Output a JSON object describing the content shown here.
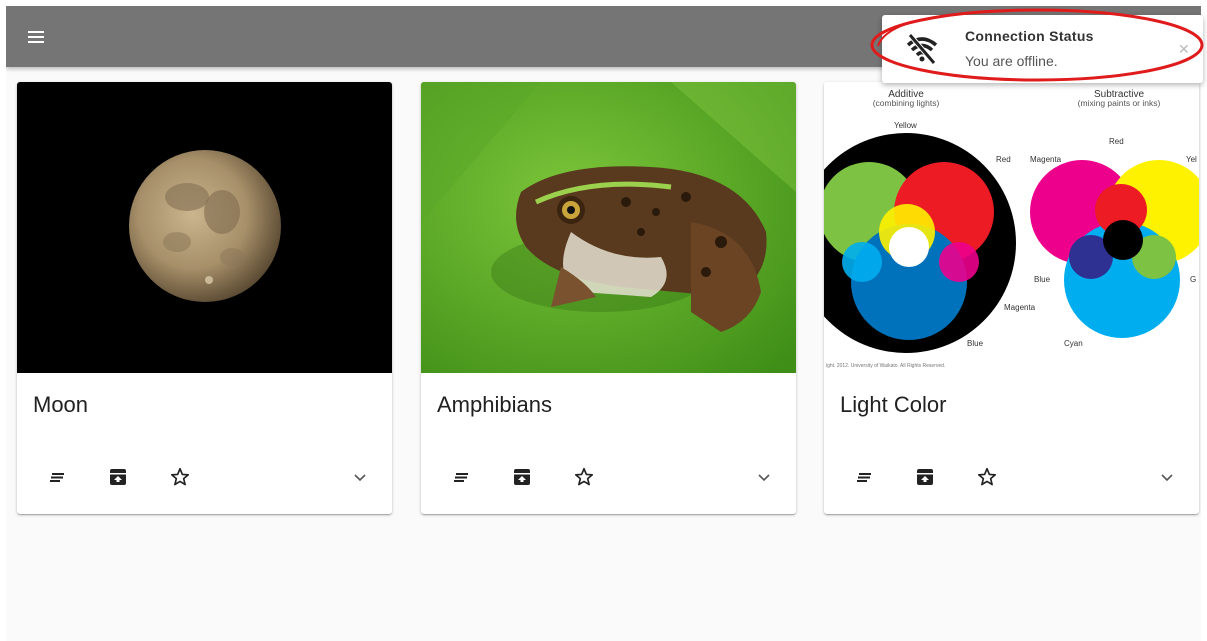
{
  "appbar": {
    "menu_icon": "menu-icon",
    "background": "#757575"
  },
  "cards": [
    {
      "title": "Moon",
      "image": "moon-photo",
      "actions": [
        "notes-icon",
        "archive-icon",
        "star-outline-icon"
      ],
      "expand": "chevron-down-icon"
    },
    {
      "title": "Amphibians",
      "image": "frog-photo",
      "actions": [
        "notes-icon",
        "archive-icon",
        "star-outline-icon"
      ],
      "expand": "chevron-down-icon"
    },
    {
      "title": "Light Color",
      "image": "color-mixing-diagram",
      "actions": [
        "notes-icon",
        "archive-icon",
        "star-outline-icon"
      ],
      "expand": "chevron-down-icon"
    }
  ],
  "diagram": {
    "additive_title": "Additive",
    "additive_sub": "(combining lights)",
    "subtractive_title": "Subtractive",
    "subtractive_sub": "(mixing paints or inks)",
    "labels": {
      "yellow": "Yellow",
      "red": "Red",
      "magenta": "Magenta",
      "blue": "Blue",
      "red2": "Red",
      "magenta2": "Magenta",
      "yel2": "Yel",
      "blue2": "Blue",
      "g2": "G",
      "cyan2": "Cyan"
    },
    "copyright": "ight. 2012. University of Waikato. All Rights Reserved."
  },
  "toast": {
    "title": "Connection Status",
    "message": "You are offline.",
    "icon": "wifi-off-icon",
    "close_icon": "close-icon"
  },
  "colors": {
    "highlight": "#e01b1b",
    "background": "#fafafa"
  }
}
